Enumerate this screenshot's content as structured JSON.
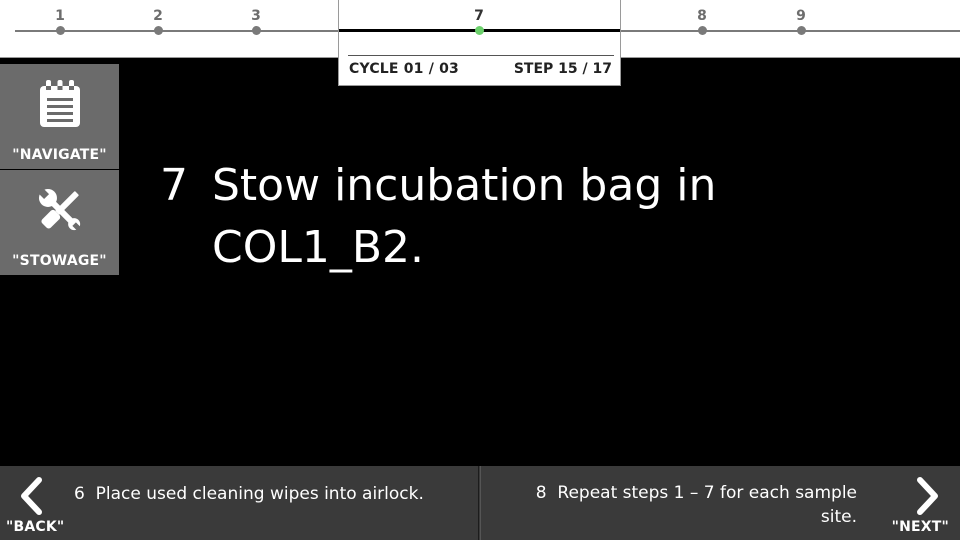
{
  "progress": {
    "steps": [
      {
        "number": "1",
        "current": false
      },
      {
        "number": "2",
        "current": false
      },
      {
        "number": "3",
        "current": false
      },
      {
        "number": "7",
        "current": true
      },
      {
        "number": "8",
        "current": false
      },
      {
        "number": "9",
        "current": false
      }
    ],
    "cycle_label": "CYCLE 01 / 03",
    "step_label": "STEP 15 / 17",
    "current_color": "#6cd06c"
  },
  "side_buttons": {
    "navigate": {
      "label": "\"NAVIGATE\"",
      "icon": "notepad-icon"
    },
    "stowage": {
      "label": "\"STOWAGE\"",
      "icon": "wrench-screwdriver-icon"
    }
  },
  "instruction": {
    "number": "7",
    "text": "Stow incubation bag in COL1_B2."
  },
  "navigation": {
    "back": {
      "command": "\"BACK\"",
      "number": "6",
      "text": "Place used cleaning wipes into airlock.",
      "icon": "chevron-left-icon"
    },
    "next": {
      "command": "\"NEXT\"",
      "number": "8",
      "text": "Repeat steps 1 – 7 for each sample site.",
      "icon": "chevron-right-icon"
    }
  }
}
